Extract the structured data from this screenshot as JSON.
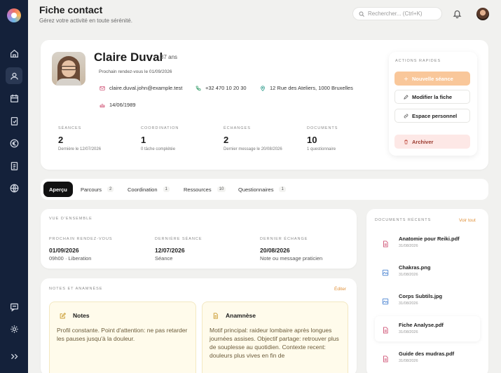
{
  "header": {
    "title": "Fiche contact",
    "subtitle": "Gérez votre activité en toute sérénité.",
    "search_placeholder": "Rechercher... (Ctrl+K)"
  },
  "sidebar": {
    "items": [
      {
        "icon": "home-icon"
      },
      {
        "icon": "contacts-icon",
        "active": true
      },
      {
        "icon": "calendar-icon"
      },
      {
        "icon": "clipboard-check-icon"
      },
      {
        "icon": "euro-icon"
      },
      {
        "icon": "clipboard-icon"
      },
      {
        "icon": "globe-icon"
      },
      {
        "icon": "messages-icon"
      },
      {
        "icon": "settings-icon"
      },
      {
        "icon": "expand-icon"
      }
    ]
  },
  "profile": {
    "name": "Claire Duval",
    "age": "37 ans",
    "next_appointment": "Prochain rendez-vous le 01/09/2026",
    "email": "claire.duval.john@example.test",
    "phone": "+32 470 10 20 30",
    "address": "12 Rue des Ateliers, 1000 Bruxelles",
    "birthdate": "14/06/1989"
  },
  "stats": [
    {
      "label": "SÉANCES",
      "value": "2",
      "sub": "Dernière le 12/07/2026"
    },
    {
      "label": "COORDINATION",
      "value": "1",
      "sub": "0 tâche complétée"
    },
    {
      "label": "ÉCHANGES",
      "value": "2",
      "sub": "Dernier message le 20/08/2026"
    },
    {
      "label": "DOCUMENTS",
      "value": "10",
      "sub": "1 questionnaire"
    }
  ],
  "quick_actions": {
    "title": "ACTIONS RAPIDES",
    "new_session": "Nouvelle séance",
    "edit": "Modifier la fiche",
    "personal_space": "Espace personnel",
    "archive": "Archiver"
  },
  "tabs": [
    {
      "label": "Aperçu",
      "count": ""
    },
    {
      "label": "Parcours",
      "count": "2"
    },
    {
      "label": "Coordination",
      "count": "1"
    },
    {
      "label": "Ressources",
      "count": "10"
    },
    {
      "label": "Questionnaires",
      "count": "1"
    }
  ],
  "overview": {
    "title": "VUE D'ENSEMBLE",
    "next": {
      "label": "PROCHAIN RENDEZ-VOUS",
      "value": "01/09/2026",
      "sub": "09h00 · Liberation"
    },
    "last_session": {
      "label": "DERNIÈRE SÉANCE",
      "value": "12/07/2026",
      "sub": "Séance"
    },
    "last_exchange": {
      "label": "DERNIER ÉCHANGE",
      "value": "20/08/2026",
      "sub": "Note ou message praticien"
    }
  },
  "notes": {
    "title": "NOTES ET ANAMNÈSE",
    "edit": "Éditer",
    "notes_title": "Notes",
    "notes_body": "Profil constante. Point d'attention: ne pas retarder les pauses jusqu'à la douleur.",
    "anamnesis_title": "Anamnèse",
    "anamnesis_body": "Motif principal: raideur lombaire après longues journées assises. Objectif partage: retrouver plus de souplesse au quotidien. Contexte recent: douleurs plus vives en fin de"
  },
  "documents": {
    "title": "DOCUMENTS RÉCENTS",
    "see_all": "Voir tout",
    "items": [
      {
        "name": "Anatomie pour Reiki.pdf",
        "date": "31/08/2026",
        "type": "pdf"
      },
      {
        "name": "Chakras.png",
        "date": "31/08/2026",
        "type": "image"
      },
      {
        "name": "Corps Subtils.jpg",
        "date": "31/08/2026",
        "type": "image"
      },
      {
        "name": "Fiche Analyse.pdf",
        "date": "31/08/2026",
        "type": "pdf"
      },
      {
        "name": "Guide des mudras.pdf",
        "date": "31/08/2026",
        "type": "pdf"
      }
    ]
  },
  "colors": {
    "sidebar": "#14213a",
    "accent": "#f9c79a",
    "danger_bg": "#fde8e6",
    "link": "#e0913a"
  }
}
